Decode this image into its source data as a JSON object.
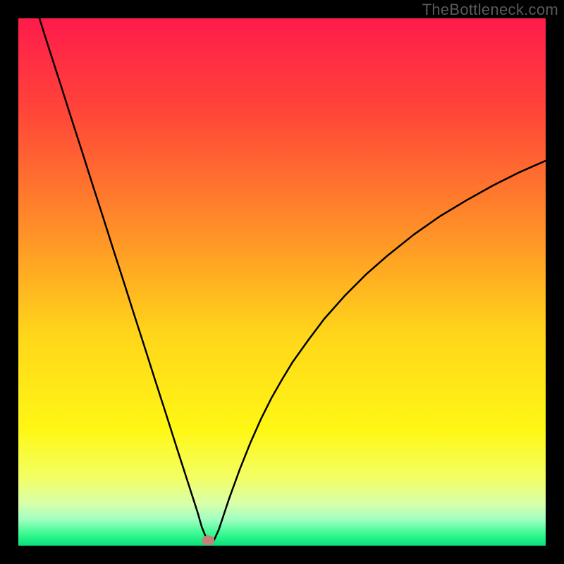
{
  "watermark": "TheBottleneck.com",
  "colors": {
    "frame": "#000000",
    "curve": "#000000",
    "marker_fill": "#c68079",
    "gradient_stops": [
      {
        "offset": 0,
        "color": "#ff1b4b"
      },
      {
        "offset": 18,
        "color": "#ff4638"
      },
      {
        "offset": 40,
        "color": "#ff8f28"
      },
      {
        "offset": 60,
        "color": "#ffd61a"
      },
      {
        "offset": 78,
        "color": "#fff714"
      },
      {
        "offset": 87,
        "color": "#f3ff63"
      },
      {
        "offset": 92,
        "color": "#d8ffa9"
      },
      {
        "offset": 95,
        "color": "#a1ffc1"
      },
      {
        "offset": 98,
        "color": "#30f88d"
      },
      {
        "offset": 100,
        "color": "#09e07a"
      }
    ]
  },
  "chart_data": {
    "type": "line",
    "title": "",
    "xlabel": "",
    "ylabel": "",
    "xlim": [
      0,
      100
    ],
    "ylim": [
      0,
      100
    ],
    "grid": false,
    "legend": false,
    "marker": {
      "x": 36,
      "y": 1
    },
    "x": [
      4,
      6,
      8,
      10,
      12,
      14,
      16,
      18,
      20,
      22,
      24,
      26,
      28,
      30,
      31,
      32,
      33,
      34,
      34.8,
      35.5,
      36,
      37,
      38,
      39,
      40,
      42,
      44,
      46,
      48,
      50,
      52,
      55,
      58,
      62,
      66,
      70,
      75,
      80,
      85,
      90,
      95,
      100
    ],
    "y": [
      100,
      93.7,
      87.5,
      81.2,
      75,
      68.7,
      62.5,
      56.2,
      50,
      43.7,
      37.5,
      31.2,
      25,
      18.7,
      15.6,
      12.5,
      9.4,
      6.3,
      3.5,
      1.8,
      0.8,
      0.8,
      3,
      6,
      9,
      14.5,
      19.5,
      24,
      28,
      31.5,
      34.8,
      39,
      43,
      47.5,
      51.5,
      55,
      59,
      62.5,
      65.5,
      68.3,
      70.8,
      73
    ]
  }
}
